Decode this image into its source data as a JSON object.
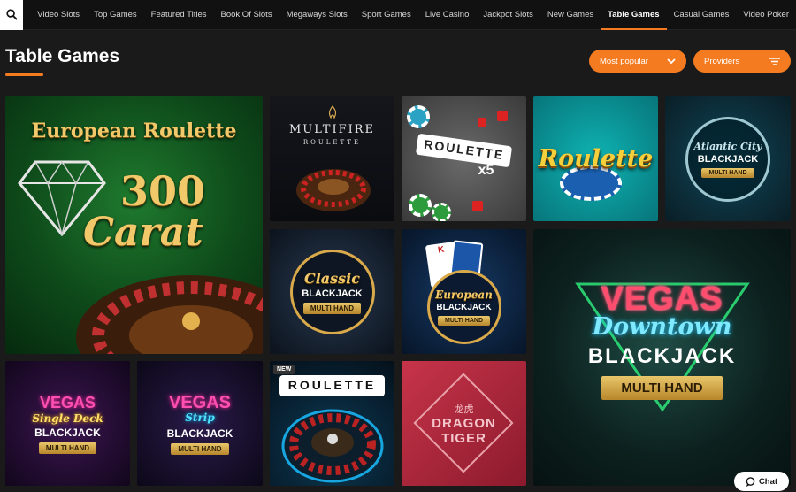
{
  "nav": {
    "items": [
      "Video Slots",
      "Top Games",
      "Featured Titles",
      "Book Of Slots",
      "Megaways Slots",
      "Sport Games",
      "Live Casino",
      "Jackpot Slots",
      "New Games",
      "Table Games",
      "Casual Games",
      "Video Poker"
    ],
    "active": "Table Games"
  },
  "page": {
    "title": "Table Games"
  },
  "filters": {
    "sort_label": "Most popular",
    "providers_label": "Providers"
  },
  "tiles": [
    {
      "name": "european-roulette-300-carat",
      "line1": "European Roulette",
      "line2": "300",
      "line3": "Carat"
    },
    {
      "name": "multifire-roulette",
      "line1": "MULTIFIRE",
      "line2": "ROULETTE"
    },
    {
      "name": "roulette-x5",
      "line1": "ROULETTE",
      "line2": "x5"
    },
    {
      "name": "roulette",
      "line1": "Roulette"
    },
    {
      "name": "atlantic-city-blackjack",
      "line1": "Atlantic City",
      "line2": "BLACKJACK",
      "line3": "MULTI HAND"
    },
    {
      "name": "classic-blackjack",
      "line1": "Classic",
      "line2": "BLACKJACK",
      "line3": "MULTI HAND"
    },
    {
      "name": "european-blackjack",
      "line1": "European",
      "line2": "BLACKJACK",
      "line3": "MULTI HAND"
    },
    {
      "name": "vegas-downtown-blackjack",
      "line1": "VEGAS",
      "line2": "Downtown",
      "line3": "BLACKJACK",
      "line4": "MULTI HAND"
    },
    {
      "name": "vegas-single-deck-blackjack",
      "line1": "VEGAS",
      "line2": "Single Deck",
      "line3": "BLACKJACK",
      "line4": "MULTI HAND"
    },
    {
      "name": "vegas-strip-blackjack",
      "line1": "VEGAS",
      "line2": "Strip",
      "line3": "BLACKJACK",
      "line4": "MULTI HAND"
    },
    {
      "name": "roulette-new",
      "line1": "ROULETTE",
      "badge": "NEW"
    },
    {
      "name": "dragon-tiger",
      "line1": "龙虎",
      "line2": "DRAGON",
      "line3": "TIGER"
    }
  ],
  "chat": {
    "label": "Chat"
  },
  "colors": {
    "accent": "#f47b20",
    "background": "#1a1a1a"
  }
}
